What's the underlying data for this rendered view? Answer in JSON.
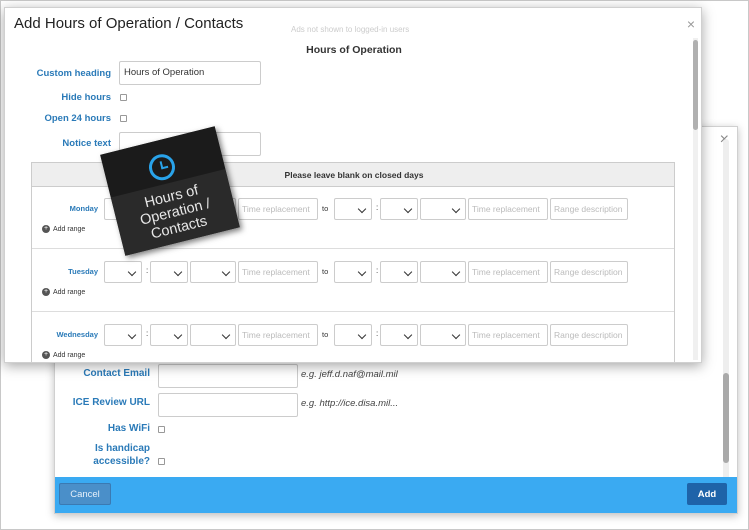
{
  "front": {
    "title": "Add Hours of Operation / Contacts",
    "close_glyph": "×",
    "background_notice": "Ads not shown to logged-in users",
    "section_header": "Hours of Operation",
    "custom_heading_label": "Custom heading",
    "custom_heading_value": "Hours of Operation",
    "hide_hours_label": "Hide hours",
    "open_24_label": "Open 24 hours",
    "notice_text_label": "Notice text",
    "table_header": "Please leave blank on closed days",
    "days": [
      {
        "name": "Monday"
      },
      {
        "name": "Tuesday"
      },
      {
        "name": "Wednesday"
      }
    ],
    "time_replacement_placeholder": "Time replacement",
    "range_description_placeholder": "Range description",
    "to_label": "to",
    "colon": ":",
    "add_range_label": "Add range",
    "plus_glyph": "+"
  },
  "badge": {
    "text": "Hours of Operation / Contacts",
    "icon": "clock-icon",
    "accent": "#29a3ea"
  },
  "back": {
    "close_glyph": "×",
    "contact_email_label": "Contact Email",
    "contact_email_hint": "e.g. jeff.d.naf@mail.mil",
    "ice_url_label": "ICE Review URL",
    "ice_url_hint": "e.g. http://ice.disa.mil...",
    "has_wifi_label": "Has WiFi",
    "handicap_label_1": "Is handicap",
    "handicap_label_2": "accessible?",
    "cancel_label": "Cancel",
    "add_label": "Add",
    "footer_color": "#3aaaf2"
  }
}
